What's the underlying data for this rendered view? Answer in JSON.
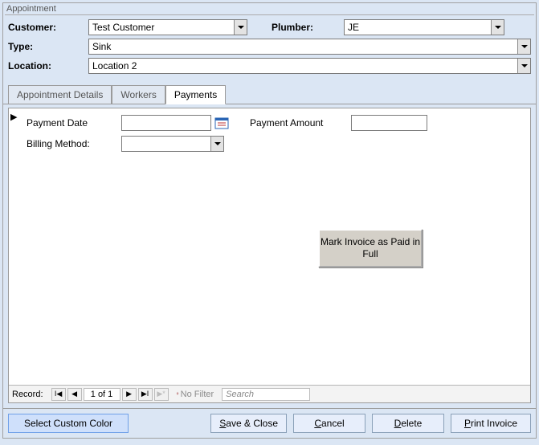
{
  "window": {
    "title": "Appointment"
  },
  "header": {
    "customer_label": "Customer:",
    "customer_value": "Test Customer",
    "plumber_label": "Plumber:",
    "plumber_value": "JE",
    "type_label": "Type:",
    "type_value": "Sink",
    "location_label": "Location:",
    "location_value": "Location 2"
  },
  "tabs": {
    "appointment": "Appointment Details",
    "workers": "Workers",
    "payments": "Payments",
    "active": "payments"
  },
  "payments": {
    "date_label": "Payment Date",
    "date_value": "",
    "amount_label": "Payment Amount",
    "amount_value": "",
    "method_label": "Billing Method:",
    "method_value": "",
    "mark_paid_label": "Mark Invoice as Paid in Full"
  },
  "recordnav": {
    "label": "Record:",
    "position": "1 of 1",
    "no_filter": "No Filter",
    "search_placeholder": "Search"
  },
  "footer": {
    "select_color": "Select Custom Color",
    "save_close": "Save & Close",
    "cancel": "Cancel",
    "delete": "Delete",
    "print": "Print Invoice"
  }
}
